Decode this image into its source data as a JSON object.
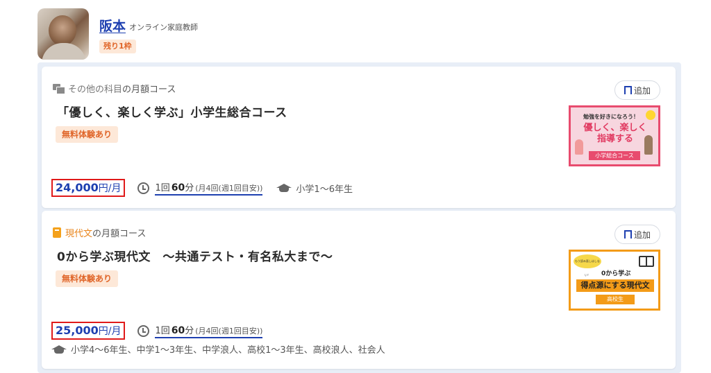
{
  "teacher": {
    "name": "阪本",
    "role": "オンライン家庭教師",
    "remaining_badge": "残り1枠"
  },
  "courses": [
    {
      "subject_name": "その他の科目",
      "subject_suffix": "の月額コース",
      "title": "「優しく、楽しく学ぶ」小学生総合コース",
      "trial_badge": "無料体験あり",
      "price_amount": "24,000",
      "price_unit": "円/月",
      "lesson_count": "1回",
      "lesson_minutes": "60",
      "lesson_minutes_unit": "分",
      "lesson_note": "(月4回(週1回目安))",
      "grades": "小学1〜6年生",
      "add_label": "追加",
      "thumbnail": {
        "small_text": "勉強を好きになろう！",
        "big_text_1": "優しく、楽しく",
        "big_text_2": "指導する",
        "band_text": "小学総合コース"
      }
    },
    {
      "subject_name": "現代文",
      "subject_suffix": "の月額コース",
      "title": "0から学ぶ現代文　〜共通テスト・有名私大まで〜",
      "trial_badge": "無料体験あり",
      "price_amount": "25,000",
      "price_unit": "円/月",
      "lesson_count": "1回",
      "lesson_minutes": "60",
      "lesson_minutes_unit": "分",
      "lesson_note": "(月4回(週1回目安))",
      "grades": "小学4〜6年生、中学1〜3年生、中学浪人、高校1〜3年生、高校浪人、社会人",
      "add_label": "追加",
      "thumbnail": {
        "tag_text": "もう読み直しはしない！",
        "line1": "0から学ぶ",
        "line2": "得点源にする現代文",
        "band_text": "高校生"
      }
    }
  ],
  "colors": {
    "price_blue": "#1d3fb0",
    "highlight_red": "#e01919",
    "badge_orange": "#e0662a",
    "badge_bg": "#fde8d8"
  },
  "icons": [
    "chat-icon",
    "book-icon",
    "clock-icon",
    "graduation-cap-icon",
    "bookmark-add-icon"
  ]
}
